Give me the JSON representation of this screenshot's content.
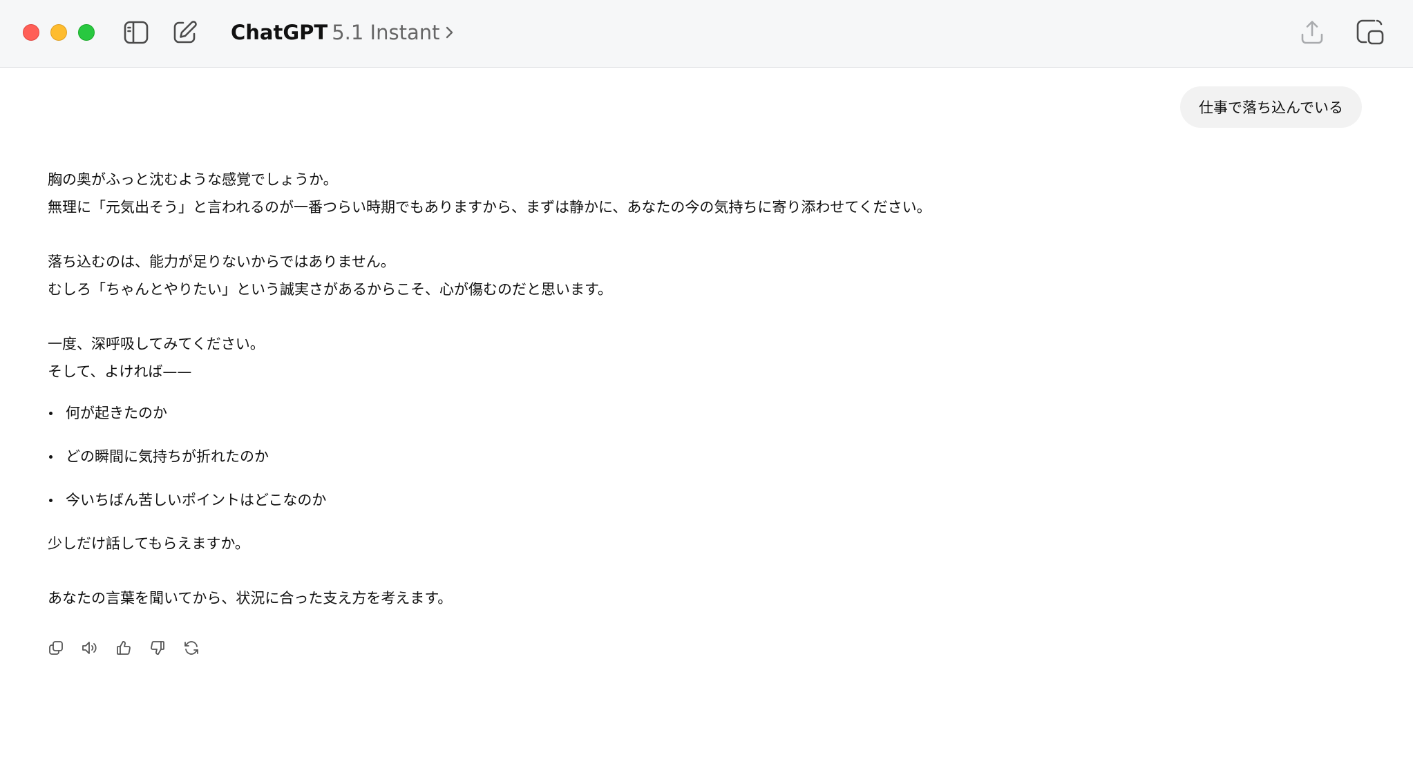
{
  "window": {
    "controls": [
      "close",
      "minimize",
      "maximize"
    ]
  },
  "header": {
    "app_name": "ChatGPT",
    "model_version": "5.1 Instant",
    "icons": {
      "sidebar_toggle": "sidebar-toggle-icon",
      "new_chat": "compose-icon",
      "share": "share-icon",
      "popout": "popout-window-icon",
      "model_menu": "chevron-right-icon"
    }
  },
  "conversation": {
    "user_message": "仕事で落ち込んでいる",
    "assistant": {
      "p1": {
        "line1": "胸の奥がふっと沈むような感覚でしょうか。",
        "line2": "無理に「元気出そう」と言われるのが一番つらい時期でもありますから、まずは静かに、あなたの今の気持ちに寄り添わせてください。"
      },
      "p2": {
        "line1": "落ち込むのは、能力が足りないからではありません。",
        "line2": "むしろ「ちゃんとやりたい」という誠実さがあるからこそ、心が傷むのだと思います。"
      },
      "p3": {
        "line1": "一度、深呼吸してみてください。",
        "line2": "そして、よければ——"
      },
      "bullets": [
        "何が起きたのか",
        "どの瞬間に気持ちが折れたのか",
        "今いちばん苦しいポイントはどこなのか"
      ],
      "p4": "少しだけ話してもらえますか。",
      "p5": "あなたの言葉を聞いてから、状況に合った支え方を考えます。"
    },
    "actions": [
      "copy-icon",
      "read-aloud-icon",
      "thumbs-up-icon",
      "thumbs-down-icon",
      "regenerate-icon"
    ]
  },
  "colors": {
    "titlebar_bg": "#f6f7f8",
    "user_bubble_bg": "#f2f2f2",
    "text": "#111111",
    "muted": "#666666",
    "close": "#ff5f57",
    "minimize": "#febc2e",
    "maximize": "#28c840"
  }
}
